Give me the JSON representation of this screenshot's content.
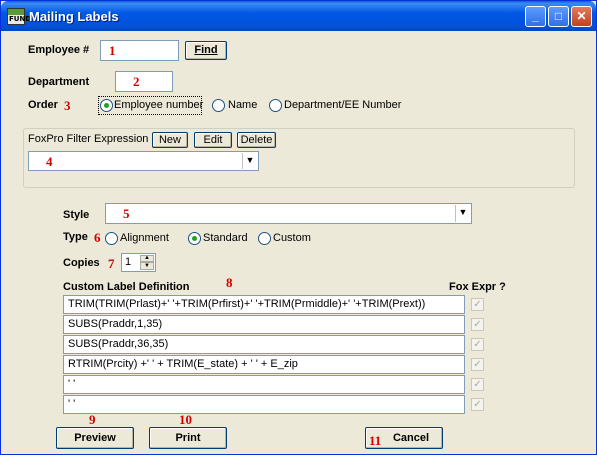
{
  "window": {
    "title": "Mailing Labels",
    "minimize": "_",
    "maximize": "□",
    "close": "✕",
    "app_icon_text": "FUND"
  },
  "employee": {
    "label": "Employee #",
    "marker": "1",
    "find": "Find"
  },
  "department": {
    "label": "Department",
    "marker": "2"
  },
  "order": {
    "label": "Order",
    "marker": "3",
    "options": [
      "Employee number",
      "Name",
      "Department/EE Number"
    ],
    "selected": "Employee number"
  },
  "filter": {
    "label": "FoxPro Filter Expression",
    "new": "New",
    "edit": "Edit",
    "delete": "Delete",
    "marker": "4"
  },
  "style": {
    "label": "Style",
    "marker": "5"
  },
  "type": {
    "label": "Type",
    "marker": "6",
    "options": [
      "Alignment",
      "Standard",
      "Custom"
    ],
    "selected": "Standard"
  },
  "copies": {
    "label": "Copies",
    "marker": "7",
    "value": "1"
  },
  "custom": {
    "label": "Custom Label Definition",
    "marker": "8",
    "fox_expr_label": "Fox Expr ?",
    "rows": [
      "TRIM(TRIM(Prlast)+' '+TRIM(Prfirst)+' '+TRIM(Prmiddle)+' '+TRIM(Prext))",
      "SUBS(Praddr,1,35)",
      "SUBS(Praddr,36,35)",
      "RTRIM(Prcity) +'  ' + TRIM(E_state) + ' ' + E_zip",
      "' '",
      "' '"
    ]
  },
  "buttons": {
    "preview": "Preview",
    "preview_marker": "9",
    "print": "Print",
    "print_marker": "10",
    "cancel": "Cancel",
    "cancel_marker": "11"
  }
}
